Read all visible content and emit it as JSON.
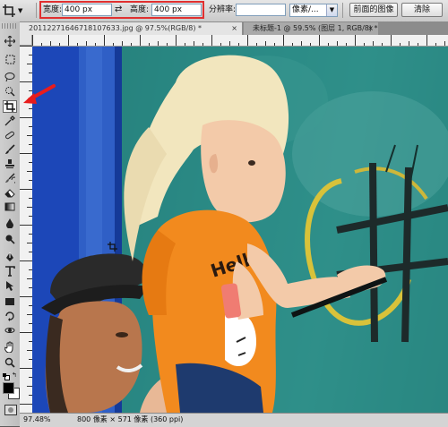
{
  "options_bar": {
    "tool_preset_icon": "crop-tool-icon",
    "width_label": "宽度:",
    "width_value": "400 px",
    "swap_icon": "⇄",
    "height_label": "高度:",
    "height_value": "400 px",
    "resolution_label": "分辨率:",
    "resolution_value": "",
    "unit_select": "像素/...",
    "front_image_button": "前面的图像",
    "clear_button": "清除",
    "highlight_color": "#e03030"
  },
  "tabs": [
    {
      "label": "20112271646718107633.jpg @ 97.5%(RGB/8) *",
      "close": "×",
      "active": true
    },
    {
      "label": "未标题-1 @ 59.5% (图层 1, RGB/8) *",
      "close": "×",
      "active": false
    }
  ],
  "toolbox": {
    "tools": [
      "move-tool-icon",
      "marquee-tool-icon",
      "lasso-tool-icon",
      "quick-selection-tool-icon",
      "crop-tool-icon",
      "eyedropper-tool-icon",
      "healing-brush-tool-icon",
      "brush-tool-icon",
      "clone-stamp-tool-icon",
      "history-brush-tool-icon",
      "eraser-tool-icon",
      "gradient-tool-icon",
      "blur-tool-icon",
      "dodge-tool-icon",
      "pen-tool-icon",
      "type-tool-icon",
      "path-selection-tool-icon",
      "rectangle-tool-icon",
      "3d-rotate-tool-icon",
      "3d-orbit-tool-icon",
      "hand-tool-icon",
      "zoom-tool-icon"
    ],
    "active_tool": "crop-tool-icon",
    "foreground_color": "#000000",
    "background_color": "#ffffff"
  },
  "status_bar": {
    "zoom": "97.48%",
    "doc_size": "800 像素 × 571 像素 (360 ppi)"
  },
  "annotation": {
    "arrow_color": "#e81c1c"
  },
  "canvas_image": {
    "shirt_text": "Hello"
  }
}
